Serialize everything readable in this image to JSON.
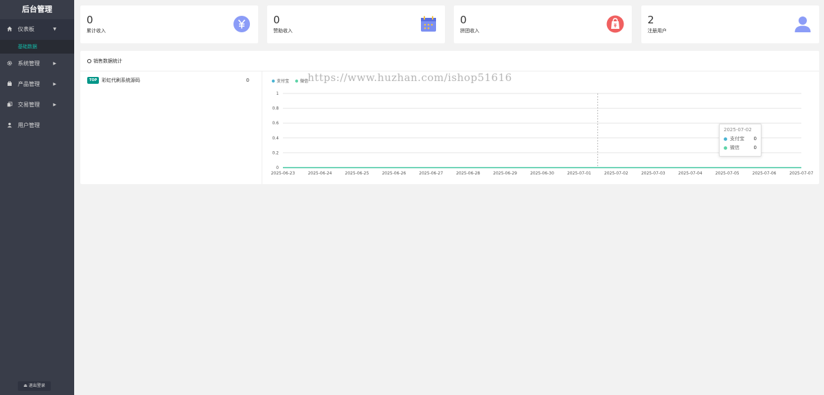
{
  "sidebar": {
    "brand": "后台管理",
    "items": [
      {
        "label": "仪表板",
        "icon": "home-icon",
        "expanded": true,
        "sub": [
          "基础数据"
        ]
      },
      {
        "label": "系统管理",
        "icon": "gear-icon"
      },
      {
        "label": "产品管理",
        "icon": "box-icon"
      },
      {
        "label": "交易管理",
        "icon": "copy-icon"
      },
      {
        "label": "用户管理",
        "icon": "user-icon"
      }
    ],
    "logout": "退出登录"
  },
  "stats": [
    {
      "value": "0",
      "label": "累计收入",
      "icon": "yuan-icon",
      "color": "#8b9cf7"
    },
    {
      "value": "0",
      "label": "赞助收入",
      "icon": "calendar-icon",
      "color": "#7b8ff2"
    },
    {
      "value": "0",
      "label": "拼团收入",
      "icon": "bag-icon",
      "color": "#f06060"
    },
    {
      "value": "2",
      "label": "注册用户",
      "icon": "person-icon",
      "color": "#8b9cf7"
    }
  ],
  "panel": {
    "title": "销售数据统计",
    "ranking": [
      {
        "badge": "TOP",
        "name": "彩虹代刷系统源码",
        "value": "0"
      }
    ]
  },
  "watermark": "https://www.huzhan.com/ishop51616",
  "chart_data": {
    "type": "line",
    "x": [
      "2025-06-23",
      "2025-06-24",
      "2025-06-25",
      "2025-06-26",
      "2025-06-27",
      "2025-06-28",
      "2025-06-29",
      "2025-06-30",
      "2025-07-01",
      "2025-07-02",
      "2025-07-03",
      "2025-07-04",
      "2025-07-05",
      "2025-07-06",
      "2025-07-07"
    ],
    "series": [
      {
        "name": "支付宝",
        "values": [
          0,
          0,
          0,
          0,
          0,
          0,
          0,
          0,
          0,
          0,
          0,
          0,
          0,
          0,
          0
        ],
        "color": "#4bb4d3"
      },
      {
        "name": "微信",
        "values": [
          0,
          0,
          0,
          0,
          0,
          0,
          0,
          0,
          0,
          0,
          0,
          0,
          0,
          0,
          0
        ],
        "color": "#5fd4a8"
      }
    ],
    "yticks": [
      "0",
      "0.2",
      "0.4",
      "0.6",
      "0.8",
      "1"
    ],
    "ylim": [
      0,
      1
    ],
    "grid": true,
    "legend": "top-left",
    "tooltip": {
      "title": "2025-07-02",
      "rows": [
        {
          "name": "支付宝",
          "value": "0"
        },
        {
          "name": "微信",
          "value": "0"
        }
      ]
    }
  }
}
